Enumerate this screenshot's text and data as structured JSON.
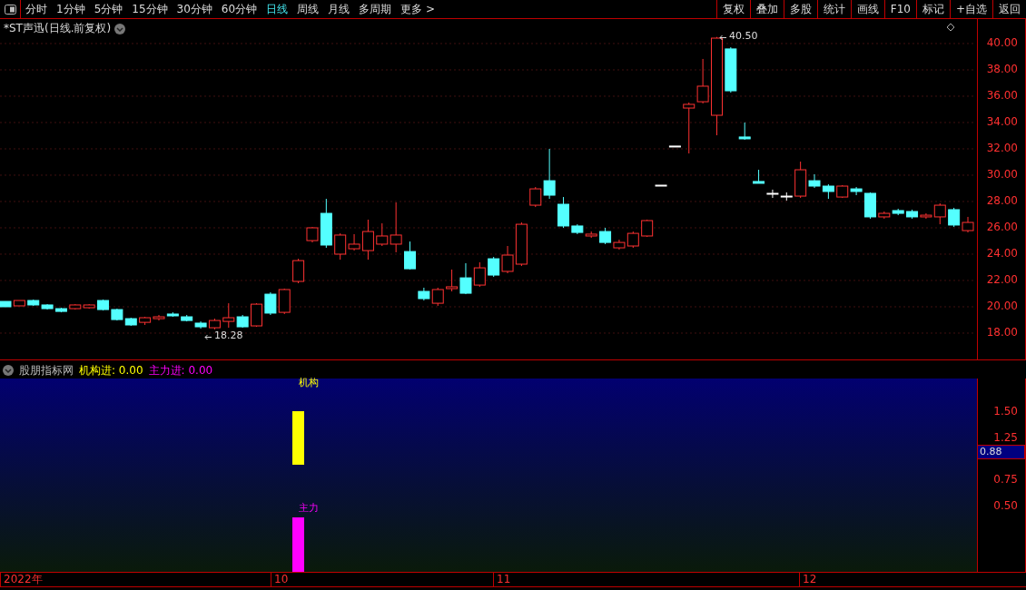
{
  "toolbar": {
    "periods": [
      {
        "label": "分时",
        "selected": false
      },
      {
        "label": "1分钟",
        "selected": false
      },
      {
        "label": "5分钟",
        "selected": false
      },
      {
        "label": "15分钟",
        "selected": false
      },
      {
        "label": "30分钟",
        "selected": false
      },
      {
        "label": "60分钟",
        "selected": false
      },
      {
        "label": "日线",
        "selected": true
      },
      {
        "label": "周线",
        "selected": false
      },
      {
        "label": "月线",
        "selected": false
      },
      {
        "label": "多周期",
        "selected": false
      },
      {
        "label": "更多 >",
        "selected": false
      }
    ],
    "actions": [
      "复权",
      "叠加",
      "多股",
      "统计",
      "画线",
      "F10",
      "标记",
      "+自选",
      "返回"
    ]
  },
  "price_chart": {
    "title": "*ST声迅(日线.前复权)",
    "high_marker": "40.50",
    "low_marker": "18.28",
    "chart_data": {
      "type": "candlestick",
      "ylim": [
        16.0,
        41.86
      ],
      "grid": true,
      "yticks": [
        {
          "value": 40,
          "label": "40.00"
        },
        {
          "value": 38,
          "label": "38.00"
        },
        {
          "value": 36,
          "label": "36.00"
        },
        {
          "value": 34,
          "label": "34.00"
        },
        {
          "value": 32,
          "label": "32.00"
        },
        {
          "value": 30,
          "label": "30.00"
        },
        {
          "value": 28,
          "label": "28.00"
        },
        {
          "value": 26,
          "label": "26.00"
        },
        {
          "value": 24,
          "label": "24.00"
        },
        {
          "value": 22,
          "label": "22.00"
        },
        {
          "value": 20,
          "label": "20.00"
        },
        {
          "value": 18,
          "label": "18.00"
        }
      ],
      "ohlc": [
        [
          20.41,
          20.41,
          20.0,
          20.0
        ],
        [
          20.07,
          20.48,
          20.07,
          20.48
        ],
        [
          20.48,
          20.55,
          20.07,
          20.14
        ],
        [
          20.14,
          20.2,
          19.79,
          19.86
        ],
        [
          19.86,
          19.93,
          19.58,
          19.65
        ],
        [
          19.86,
          20.2,
          19.79,
          20.14
        ],
        [
          19.93,
          20.2,
          19.86,
          20.14
        ],
        [
          20.48,
          20.55,
          19.72,
          19.79
        ],
        [
          19.79,
          19.86,
          18.96,
          19.03
        ],
        [
          19.1,
          19.17,
          18.55,
          18.62
        ],
        [
          18.82,
          19.24,
          18.62,
          19.17
        ],
        [
          19.1,
          19.38,
          18.96,
          19.24
        ],
        [
          19.45,
          19.58,
          19.24,
          19.31
        ],
        [
          19.24,
          19.38,
          18.89,
          18.96
        ],
        [
          18.76,
          18.89,
          18.34,
          18.48
        ],
        [
          18.41,
          19.1,
          18.28,
          18.96
        ],
        [
          18.89,
          20.27,
          18.41,
          19.17
        ],
        [
          19.24,
          19.38,
          18.41,
          18.48
        ],
        [
          18.55,
          20.27,
          18.48,
          20.2
        ],
        [
          20.96,
          21.1,
          19.38,
          19.52
        ],
        [
          19.58,
          21.38,
          19.45,
          21.31
        ],
        [
          21.93,
          23.65,
          21.79,
          23.51
        ],
        [
          25.03,
          26.07,
          24.89,
          26.0
        ],
        [
          27.1,
          28.2,
          24.48,
          24.69
        ],
        [
          24.0,
          25.58,
          23.58,
          25.45
        ],
        [
          24.41,
          25.52,
          24.27,
          24.76
        ],
        [
          24.27,
          26.62,
          23.58,
          25.72
        ],
        [
          24.76,
          26.34,
          24.62,
          25.38
        ],
        [
          24.76,
          27.93,
          24.14,
          25.45
        ],
        [
          24.2,
          24.96,
          22.83,
          22.89
        ],
        [
          21.17,
          21.45,
          20.48,
          20.62
        ],
        [
          20.27,
          21.45,
          20.07,
          21.31
        ],
        [
          21.38,
          22.83,
          21.17,
          21.52
        ],
        [
          22.2,
          23.31,
          20.96,
          21.03
        ],
        [
          21.65,
          23.38,
          21.52,
          22.96
        ],
        [
          23.65,
          23.79,
          22.27,
          22.41
        ],
        [
          22.69,
          24.62,
          22.55,
          23.93
        ],
        [
          23.24,
          26.41,
          23.1,
          26.27
        ],
        [
          27.72,
          29.1,
          27.58,
          28.96
        ],
        [
          29.58,
          32.0,
          28.2,
          28.48
        ],
        [
          27.79,
          28.34,
          26.0,
          26.14
        ],
        [
          26.14,
          26.27,
          25.52,
          25.65
        ],
        [
          25.38,
          25.72,
          25.24,
          25.52
        ],
        [
          25.72,
          26.0,
          24.76,
          24.89
        ],
        [
          24.48,
          25.1,
          24.34,
          24.89
        ],
        [
          24.62,
          25.72,
          24.48,
          25.58
        ],
        [
          25.38,
          26.62,
          25.31,
          26.55
        ],
        [
          29.24,
          29.24,
          29.24,
          29.24
        ],
        [
          32.21,
          32.21,
          32.21,
          32.21
        ],
        [
          35.1,
          35.52,
          31.65,
          35.38
        ],
        [
          35.58,
          38.83,
          35.45,
          36.76
        ],
        [
          34.55,
          40.5,
          33.03,
          40.41
        ],
        [
          39.59,
          39.72,
          36.27,
          36.41
        ],
        [
          32.9,
          34.0,
          32.69,
          32.76
        ],
        [
          29.52,
          30.41,
          29.38,
          29.38
        ],
        [
          28.62,
          28.9,
          28.27,
          28.62
        ],
        [
          28.41,
          28.69,
          28.07,
          28.41
        ],
        [
          28.41,
          31.03,
          28.27,
          30.41
        ],
        [
          29.58,
          30.07,
          29.03,
          29.17
        ],
        [
          29.17,
          29.31,
          28.2,
          28.76
        ],
        [
          28.34,
          29.24,
          28.27,
          29.17
        ],
        [
          28.96,
          29.1,
          28.48,
          28.76
        ],
        [
          28.62,
          28.69,
          26.69,
          26.83
        ],
        [
          26.83,
          27.24,
          26.69,
          27.1
        ],
        [
          27.31,
          27.45,
          26.96,
          27.1
        ],
        [
          27.24,
          27.38,
          26.69,
          26.83
        ],
        [
          26.83,
          27.1,
          26.69,
          26.96
        ],
        [
          26.83,
          27.86,
          26.27,
          27.72
        ],
        [
          27.38,
          27.52,
          26.07,
          26.21
        ],
        [
          25.79,
          26.83,
          25.65,
          26.41
        ]
      ]
    }
  },
  "indicator": {
    "name": "股朋指标网",
    "legend": [
      {
        "label": "机构进: 0.00",
        "color": "#ffff00"
      },
      {
        "label": "主力进: 0.00",
        "color": "#ff00ff"
      }
    ],
    "bars": [
      {
        "label": "机构",
        "color": "#ffff00"
      },
      {
        "label": "主力",
        "color": "#ff00ff"
      }
    ],
    "axis_labels": [
      "1.50",
      "1.25",
      "0.75",
      "0.50"
    ],
    "current_value": "0.88"
  },
  "time_axis": [
    "2022年",
    "10",
    "11",
    "12"
  ]
}
